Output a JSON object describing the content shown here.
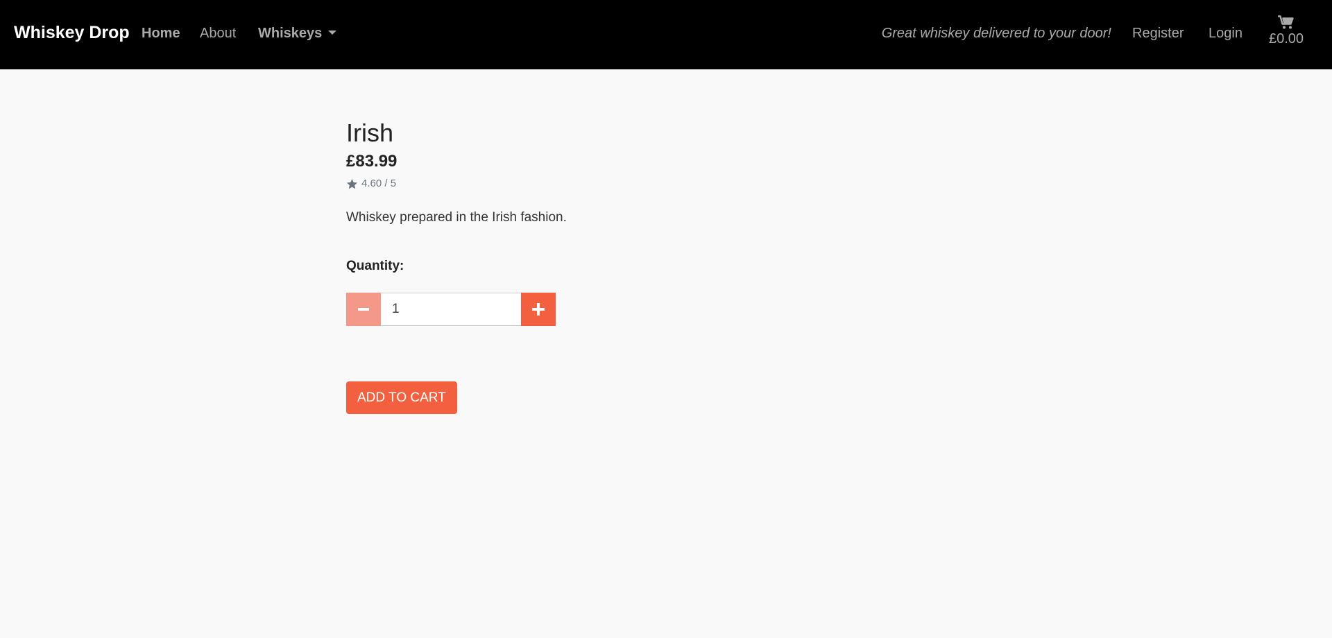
{
  "nav": {
    "brand": "Whiskey Drop",
    "links": {
      "home": "Home",
      "about": "About",
      "whiskeys": "Whiskeys",
      "register": "Register",
      "login": "Login"
    },
    "tagline": "Great whiskey delivered to your door!",
    "cart": {
      "icon": "shopping-cart-icon",
      "total": "£0.00"
    }
  },
  "product": {
    "name": "Irish",
    "price": "£83.99",
    "rating": {
      "icon": "star-icon",
      "text": "4.60 / 5"
    },
    "description": "Whiskey prepared in the Irish fashion.",
    "quantity": {
      "label": "Quantity:",
      "value": "1",
      "decrement_icon": "minus-icon",
      "increment_icon": "plus-icon"
    },
    "add_to_cart_label": "ADD TO CART"
  },
  "colors": {
    "navbar_bg": "#000000",
    "page_bg": "#f9f9f9",
    "accent": "#f2603f",
    "accent_disabled": "#f4998a",
    "nav_text": "#aaaaaa"
  }
}
